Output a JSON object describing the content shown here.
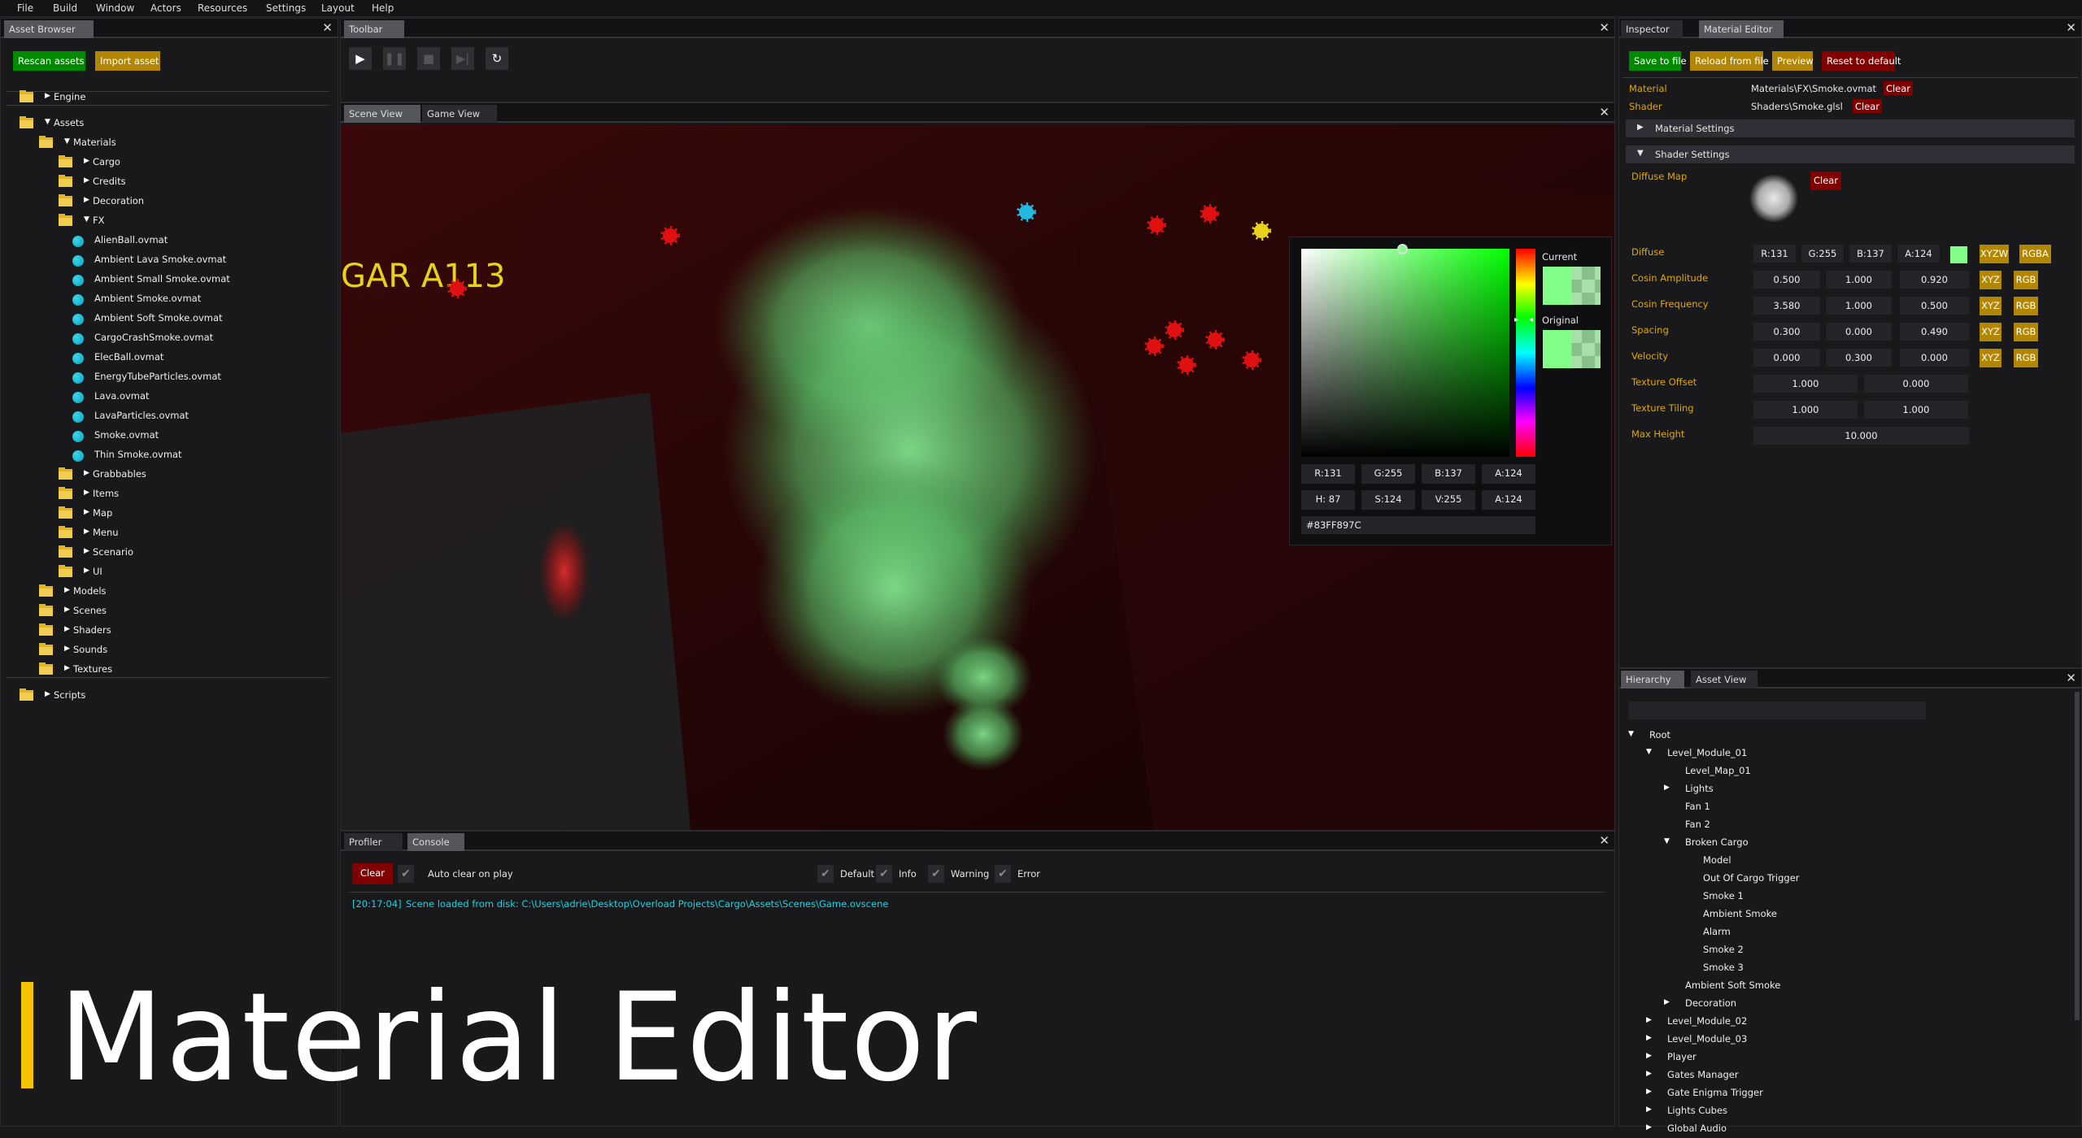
{
  "menu": [
    "File",
    "Build",
    "Window",
    "Actors",
    "Resources",
    "Settings",
    "Layout",
    "Help"
  ],
  "asset_browser": {
    "tab": "Asset Browser",
    "rescan_label": "Rescan assets",
    "import_label": "Import asset",
    "tree": [
      {
        "label": "Engine",
        "type": "folder",
        "level": 0,
        "state": "collapsed",
        "sep_after": true
      },
      {
        "label": "Assets",
        "type": "folder",
        "level": 0,
        "state": "expanded"
      },
      {
        "label": "Materials",
        "type": "folder",
        "level": 1,
        "state": "expanded"
      },
      {
        "label": "Cargo",
        "type": "folder",
        "level": 2,
        "state": "collapsed"
      },
      {
        "label": "Credits",
        "type": "folder",
        "level": 2,
        "state": "collapsed"
      },
      {
        "label": "Decoration",
        "type": "folder",
        "level": 2,
        "state": "collapsed"
      },
      {
        "label": "FX",
        "type": "folder",
        "level": 2,
        "state": "expanded"
      },
      {
        "label": "AlienBall.ovmat",
        "type": "material",
        "level": 3
      },
      {
        "label": "Ambient Lava Smoke.ovmat",
        "type": "material",
        "level": 3
      },
      {
        "label": "Ambient Small Smoke.ovmat",
        "type": "material",
        "level": 3
      },
      {
        "label": "Ambient Smoke.ovmat",
        "type": "material",
        "level": 3
      },
      {
        "label": "Ambient Soft Smoke.ovmat",
        "type": "material",
        "level": 3
      },
      {
        "label": "CargoCrashSmoke.ovmat",
        "type": "material",
        "level": 3
      },
      {
        "label": "ElecBall.ovmat",
        "type": "material",
        "level": 3
      },
      {
        "label": "EnergyTubeParticles.ovmat",
        "type": "material",
        "level": 3
      },
      {
        "label": "Lava.ovmat",
        "type": "material",
        "level": 3
      },
      {
        "label": "LavaParticles.ovmat",
        "type": "material",
        "level": 3
      },
      {
        "label": "Smoke.ovmat",
        "type": "material",
        "level": 3
      },
      {
        "label": "Thin Smoke.ovmat",
        "type": "material",
        "level": 3
      },
      {
        "label": "Grabbables",
        "type": "folder",
        "level": 2,
        "state": "collapsed"
      },
      {
        "label": "Items",
        "type": "folder",
        "level": 2,
        "state": "collapsed"
      },
      {
        "label": "Map",
        "type": "folder",
        "level": 2,
        "state": "collapsed"
      },
      {
        "label": "Menu",
        "type": "folder",
        "level": 2,
        "state": "collapsed"
      },
      {
        "label": "Scenario",
        "type": "folder",
        "level": 2,
        "state": "collapsed"
      },
      {
        "label": "UI",
        "type": "folder",
        "level": 2,
        "state": "collapsed"
      },
      {
        "label": "Models",
        "type": "folder",
        "level": 1,
        "state": "collapsed"
      },
      {
        "label": "Scenes",
        "type": "folder",
        "level": 1,
        "state": "collapsed"
      },
      {
        "label": "Shaders",
        "type": "folder",
        "level": 1,
        "state": "collapsed"
      },
      {
        "label": "Sounds",
        "type": "folder",
        "level": 1,
        "state": "collapsed"
      },
      {
        "label": "Textures",
        "type": "folder",
        "level": 1,
        "state": "collapsed",
        "sep_after": true
      },
      {
        "label": "Scripts",
        "type": "folder",
        "level": 0,
        "state": "collapsed"
      }
    ]
  },
  "toolbar": {
    "tab": "Toolbar",
    "buttons": [
      {
        "icon": "play-icon",
        "glyph": "▶",
        "enabled": true
      },
      {
        "icon": "pause-icon",
        "glyph": "❚❚",
        "enabled": false
      },
      {
        "icon": "stop-icon",
        "glyph": "■",
        "enabled": false
      },
      {
        "icon": "step-icon",
        "glyph": "▶|",
        "enabled": false
      },
      {
        "icon": "refresh-icon",
        "glyph": "↻",
        "enabled": true
      }
    ]
  },
  "views": {
    "tabs": [
      "Scene View",
      "Game View"
    ],
    "active": "Scene View",
    "scene_sign": "GAR A113"
  },
  "color_picker": {
    "current_label": "Current",
    "original_label": "Original",
    "rgba": [
      "R:131",
      "G:255",
      "B:137",
      "A:124"
    ],
    "hsva": [
      "H: 87",
      "S:124",
      "V:255",
      "A:124"
    ],
    "hex": "#83FF897C",
    "color": "#83FF89"
  },
  "console": {
    "tabs": [
      "Profiler",
      "Console"
    ],
    "active": "Console",
    "clear_label": "Clear",
    "auto_clear_label": "Auto clear on play",
    "filters": [
      "Default",
      "Info",
      "Warning",
      "Error"
    ],
    "log": [
      {
        "time": "[20:17:04]",
        "message": "Scene loaded from disk: C:\\Users\\adrie\\Desktop\\Overload Projects\\Cargo\\Assets\\Scenes\\Game.ovscene",
        "color": "#19d3e0"
      }
    ]
  },
  "right_panel": {
    "tabs": [
      "Inspector",
      "Material Editor"
    ],
    "active": "Material Editor",
    "buttons": [
      "Save to file",
      "Reload from file",
      "Preview",
      "Reset to default"
    ],
    "material_label": "Material",
    "material_value": "Materials\\FX\\Smoke.ovmat",
    "shader_label": "Shader",
    "shader_value": "Shaders\\Smoke.glsl",
    "clear_label": "Clear",
    "material_settings": "Material Settings",
    "shader_settings": "Shader Settings",
    "diffuse_map_label": "Diffuse Map",
    "diffuse": {
      "label": "Diffuse",
      "values": [
        "R:131",
        "G:255",
        "B:137",
        "A:124"
      ],
      "swatch": "#83FF89",
      "btn1": "XYZW",
      "btn2": "RGBA"
    },
    "vec3_rows": [
      {
        "label": "Cosin Amplitude",
        "values": [
          "0.500",
          "1.000",
          "0.920"
        ]
      },
      {
        "label": "Cosin Frequency",
        "values": [
          "3.580",
          "1.000",
          "0.500"
        ]
      },
      {
        "label": "Spacing",
        "values": [
          "0.300",
          "0.000",
          "0.490"
        ]
      },
      {
        "label": "Velocity",
        "values": [
          "0.000",
          "0.300",
          "0.000"
        ]
      }
    ],
    "vec3_btn1": "XYZ",
    "vec3_btn2": "RGB",
    "vec2_rows": [
      {
        "label": "Texture Offset",
        "values": [
          "1.000",
          "0.000"
        ]
      },
      {
        "label": "Texture Tiling",
        "values": [
          "1.000",
          "1.000"
        ]
      }
    ],
    "max_height": {
      "label": "Max Height",
      "value": "10.000"
    }
  },
  "hierarchy": {
    "tabs": [
      "Hierarchy",
      "Asset View"
    ],
    "active": "Hierarchy",
    "search_value": "",
    "items": [
      {
        "label": "Root",
        "level": 0,
        "state": "expanded"
      },
      {
        "label": "Level_Module_01",
        "level": 1,
        "state": "expanded"
      },
      {
        "label": "Level_Map_01",
        "level": 2
      },
      {
        "label": "Lights",
        "level": 2,
        "state": "collapsed"
      },
      {
        "label": "Fan 1",
        "level": 2
      },
      {
        "label": "Fan 2",
        "level": 2
      },
      {
        "label": "Broken Cargo",
        "level": 2,
        "state": "expanded"
      },
      {
        "label": "Model",
        "level": 3
      },
      {
        "label": "Out Of Cargo Trigger",
        "level": 3
      },
      {
        "label": "Smoke 1",
        "level": 3
      },
      {
        "label": "Ambient Smoke",
        "level": 3
      },
      {
        "label": "Alarm",
        "level": 3
      },
      {
        "label": "Smoke 2",
        "level": 3
      },
      {
        "label": "Smoke 3",
        "level": 3
      },
      {
        "label": "Ambient Soft Smoke",
        "level": 2
      },
      {
        "label": "Decoration",
        "level": 2,
        "state": "collapsed"
      },
      {
        "label": "Level_Module_02",
        "level": 1,
        "state": "collapsed"
      },
      {
        "label": "Level_Module_03",
        "level": 1,
        "state": "collapsed"
      },
      {
        "label": "Player",
        "level": 1,
        "state": "collapsed"
      },
      {
        "label": "Gates Manager",
        "level": 1,
        "state": "collapsed"
      },
      {
        "label": "Gate Enigma Trigger",
        "level": 1,
        "state": "collapsed"
      },
      {
        "label": "Lights Cubes",
        "level": 1,
        "state": "collapsed"
      },
      {
        "label": "Global Audio",
        "level": 1,
        "state": "collapsed"
      }
    ]
  },
  "overlay": {
    "title": "Material Editor",
    "accent": "#f5c400"
  }
}
